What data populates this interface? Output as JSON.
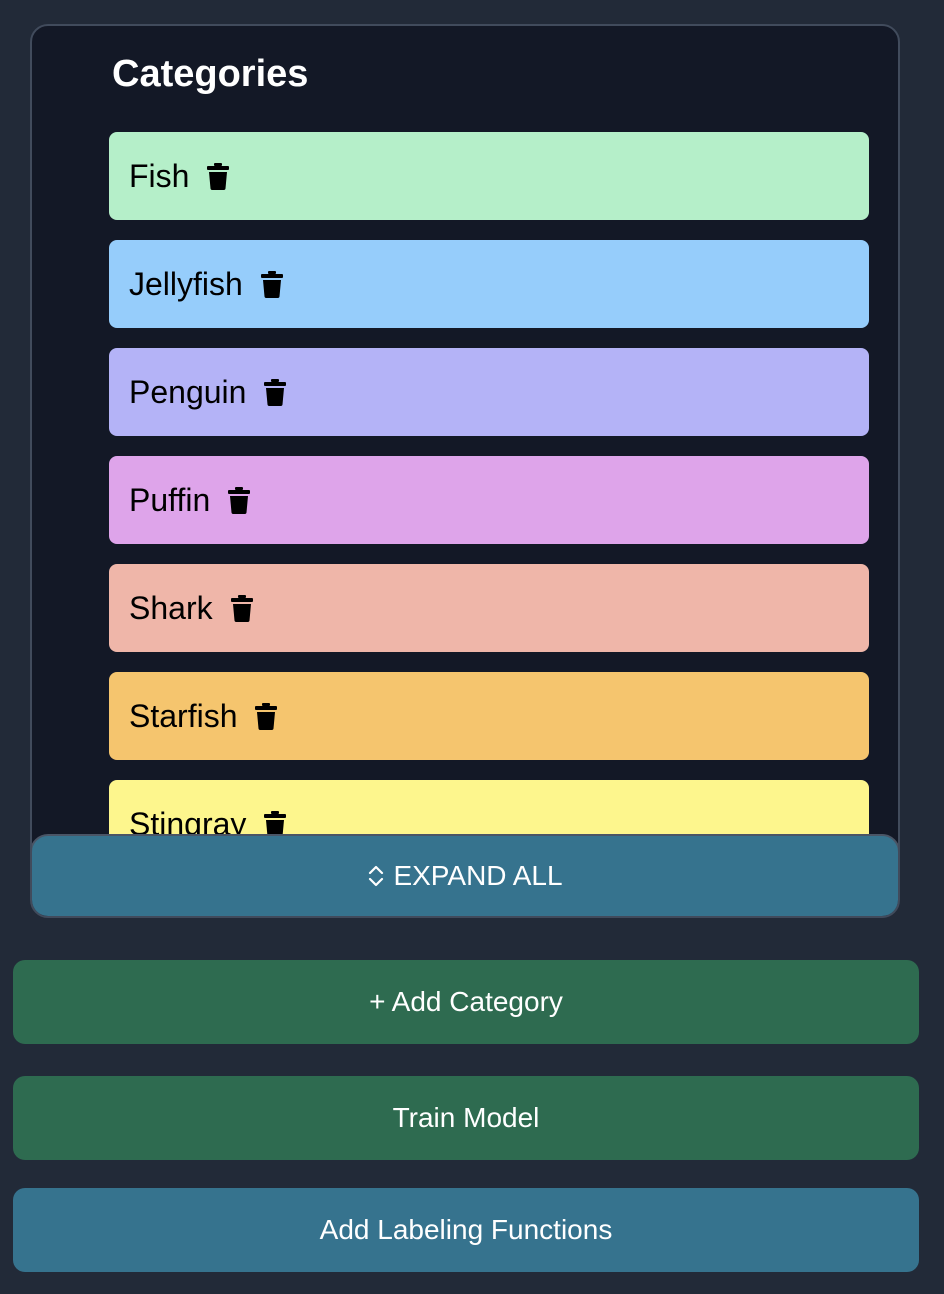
{
  "panel": {
    "title": "Categories",
    "categories": [
      {
        "label": "Fish",
        "color": "#b5efc9"
      },
      {
        "label": "Jellyfish",
        "color": "#96cdfb"
      },
      {
        "label": "Penguin",
        "color": "#b4b3f7"
      },
      {
        "label": "Puffin",
        "color": "#dea4ea"
      },
      {
        "label": "Shark",
        "color": "#efb6a9"
      },
      {
        "label": "Starfish",
        "color": "#f5c56e"
      },
      {
        "label": "Stingray",
        "color": "#fdf68d"
      }
    ],
    "expand_label": "EXPAND ALL",
    "expand_icon": "chevron-up-down-icon",
    "delete_icon": "trash-icon"
  },
  "buttons": {
    "add_category": "+ Add Category",
    "train_model": "Train Model",
    "add_labeling_functions": "Add Labeling Functions"
  },
  "colors": {
    "background": "#222a38",
    "panel": "#131826",
    "green_button": "#2e6b50",
    "blue_button": "#36738e"
  }
}
